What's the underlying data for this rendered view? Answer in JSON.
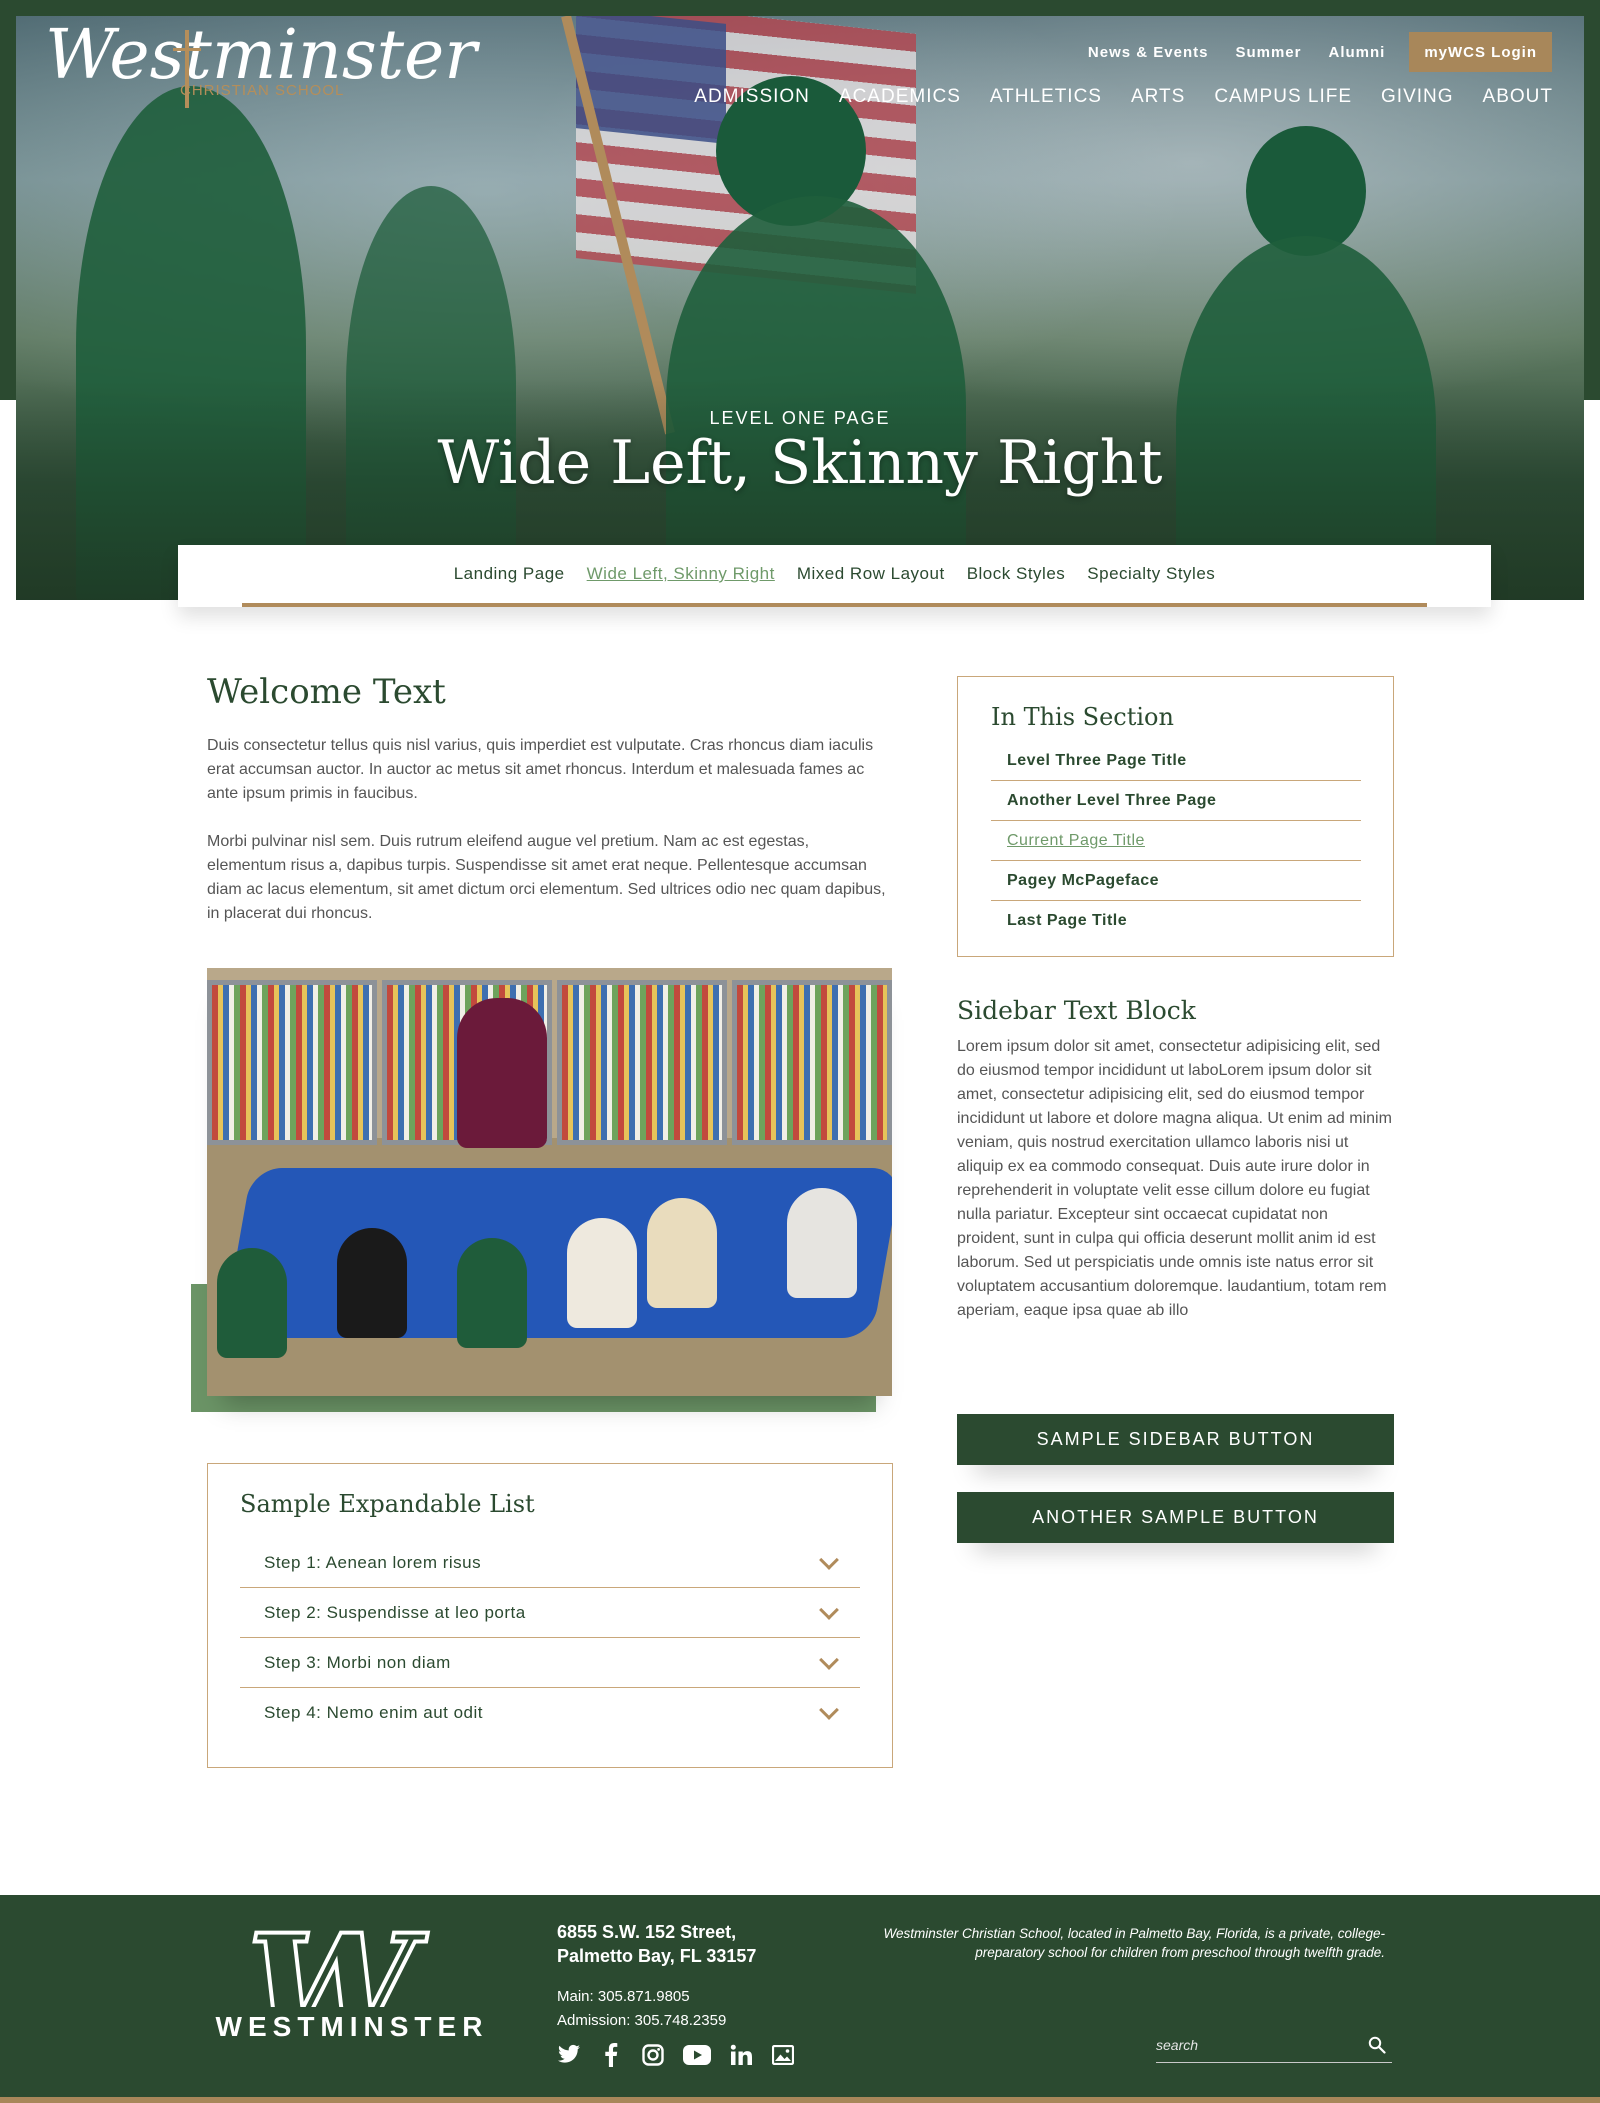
{
  "header": {
    "logo": {
      "text_main": "Westminster",
      "text_sub": "CHRISTIAN SCHOOL"
    },
    "utility_links": [
      "News & Events",
      "Summer",
      "Alumni"
    ],
    "login_button": "myWCS Login",
    "main_nav": [
      "ADMISSION",
      "ACADEMICS",
      "ATHLETICS",
      "ARTS",
      "CAMPUS LIFE",
      "GIVING",
      "ABOUT"
    ]
  },
  "hero": {
    "kicker": "LEVEL ONE PAGE",
    "title": "Wide Left, Skinny Right"
  },
  "subnav": {
    "items": [
      {
        "label": "Landing Page",
        "active": false
      },
      {
        "label": "Wide Left, Skinny Right",
        "active": true
      },
      {
        "label": "Mixed Row Layout",
        "active": false
      },
      {
        "label": "Block Styles",
        "active": false
      },
      {
        "label": "Specialty Styles",
        "active": false
      }
    ]
  },
  "main": {
    "title": "Welcome Text",
    "paragraphs": [
      "Duis consectetur tellus quis nisl varius, quis imperdiet est vulputate. Cras rhoncus diam iaculis erat accumsan auctor. In auctor ac metus sit amet rhoncus. Interdum et malesuada fames ac ante ipsum primis in faucibus.",
      "Morbi pulvinar nisl sem. Duis rutrum eleifend augue vel pretium. Nam ac est egestas, elementum risus a, dapibus turpis. Suspendisse sit amet erat neque. Pellentesque accumsan diam ac lacus elementum, sit amet dictum orci elementum. Sed ultrices odio nec quam dapibus, in placerat dui rhoncus."
    ],
    "expandable": {
      "title": "Sample Expandable List",
      "items": [
        "Step 1: Aenean lorem risus",
        "Step 2: Suspendisse at leo porta",
        "Step 3: Morbi non diam",
        "Step 4: Nemo enim aut odit"
      ]
    }
  },
  "sidebar": {
    "section_title": "In This Section",
    "section_links": [
      {
        "label": "Level Three Page Title",
        "active": false
      },
      {
        "label": "Another Level Three Page",
        "active": false
      },
      {
        "label": "Current Page Title",
        "active": true
      },
      {
        "label": "Pagey McPageface",
        "active": false
      },
      {
        "label": "Last Page Title",
        "active": false
      }
    ],
    "text_title": "Sidebar Text Block",
    "text_body": "Lorem ipsum dolor sit amet, consectetur adipisicing elit, sed do eiusmod tempor incididunt ut laboLorem ipsum dolor sit amet, consectetur adipisicing elit, sed do eiusmod tempor incididunt ut labore et dolore magna aliqua. Ut enim ad minim veniam, quis nostrud exercitation ullamco laboris nisi ut aliquip ex ea commodo consequat. Duis aute irure dolor in reprehenderit in voluptate velit esse cillum dolore eu fugiat nulla pariatur. Excepteur sint occaecat cupidatat non proident, sunt in culpa qui officia deserunt mollit anim id est laborum. Sed ut perspiciatis unde omnis iste natus error sit voluptatem accusantium doloremque. laudantium, totam rem aperiam, eaque ipsa quae ab illo",
    "buttons": [
      "SAMPLE SIDEBAR BUTTON",
      "ANOTHER SAMPLE BUTTON"
    ]
  },
  "footer": {
    "logo_word": "WESTMINSTER",
    "address_line1": "6855 S.W. 152 Street,",
    "address_line2": "Palmetto Bay, FL 33157",
    "phone_main": "Main: 305.871.9805",
    "phone_admission": "Admission: 305.748.2359",
    "blurb": "Westminster Christian School, located in Palmetto Bay, Florida, is a private, college-preparatory school for children from preschool through twelfth grade.",
    "search_placeholder": "search",
    "social_icons": [
      "twitter-icon",
      "facebook-icon",
      "instagram-icon",
      "youtube-icon",
      "linkedin-icon",
      "image-icon"
    ]
  },
  "colors": {
    "brand_green": "#2b4a30",
    "gold": "#a8875a",
    "accent_green": "#6f9a6a"
  }
}
